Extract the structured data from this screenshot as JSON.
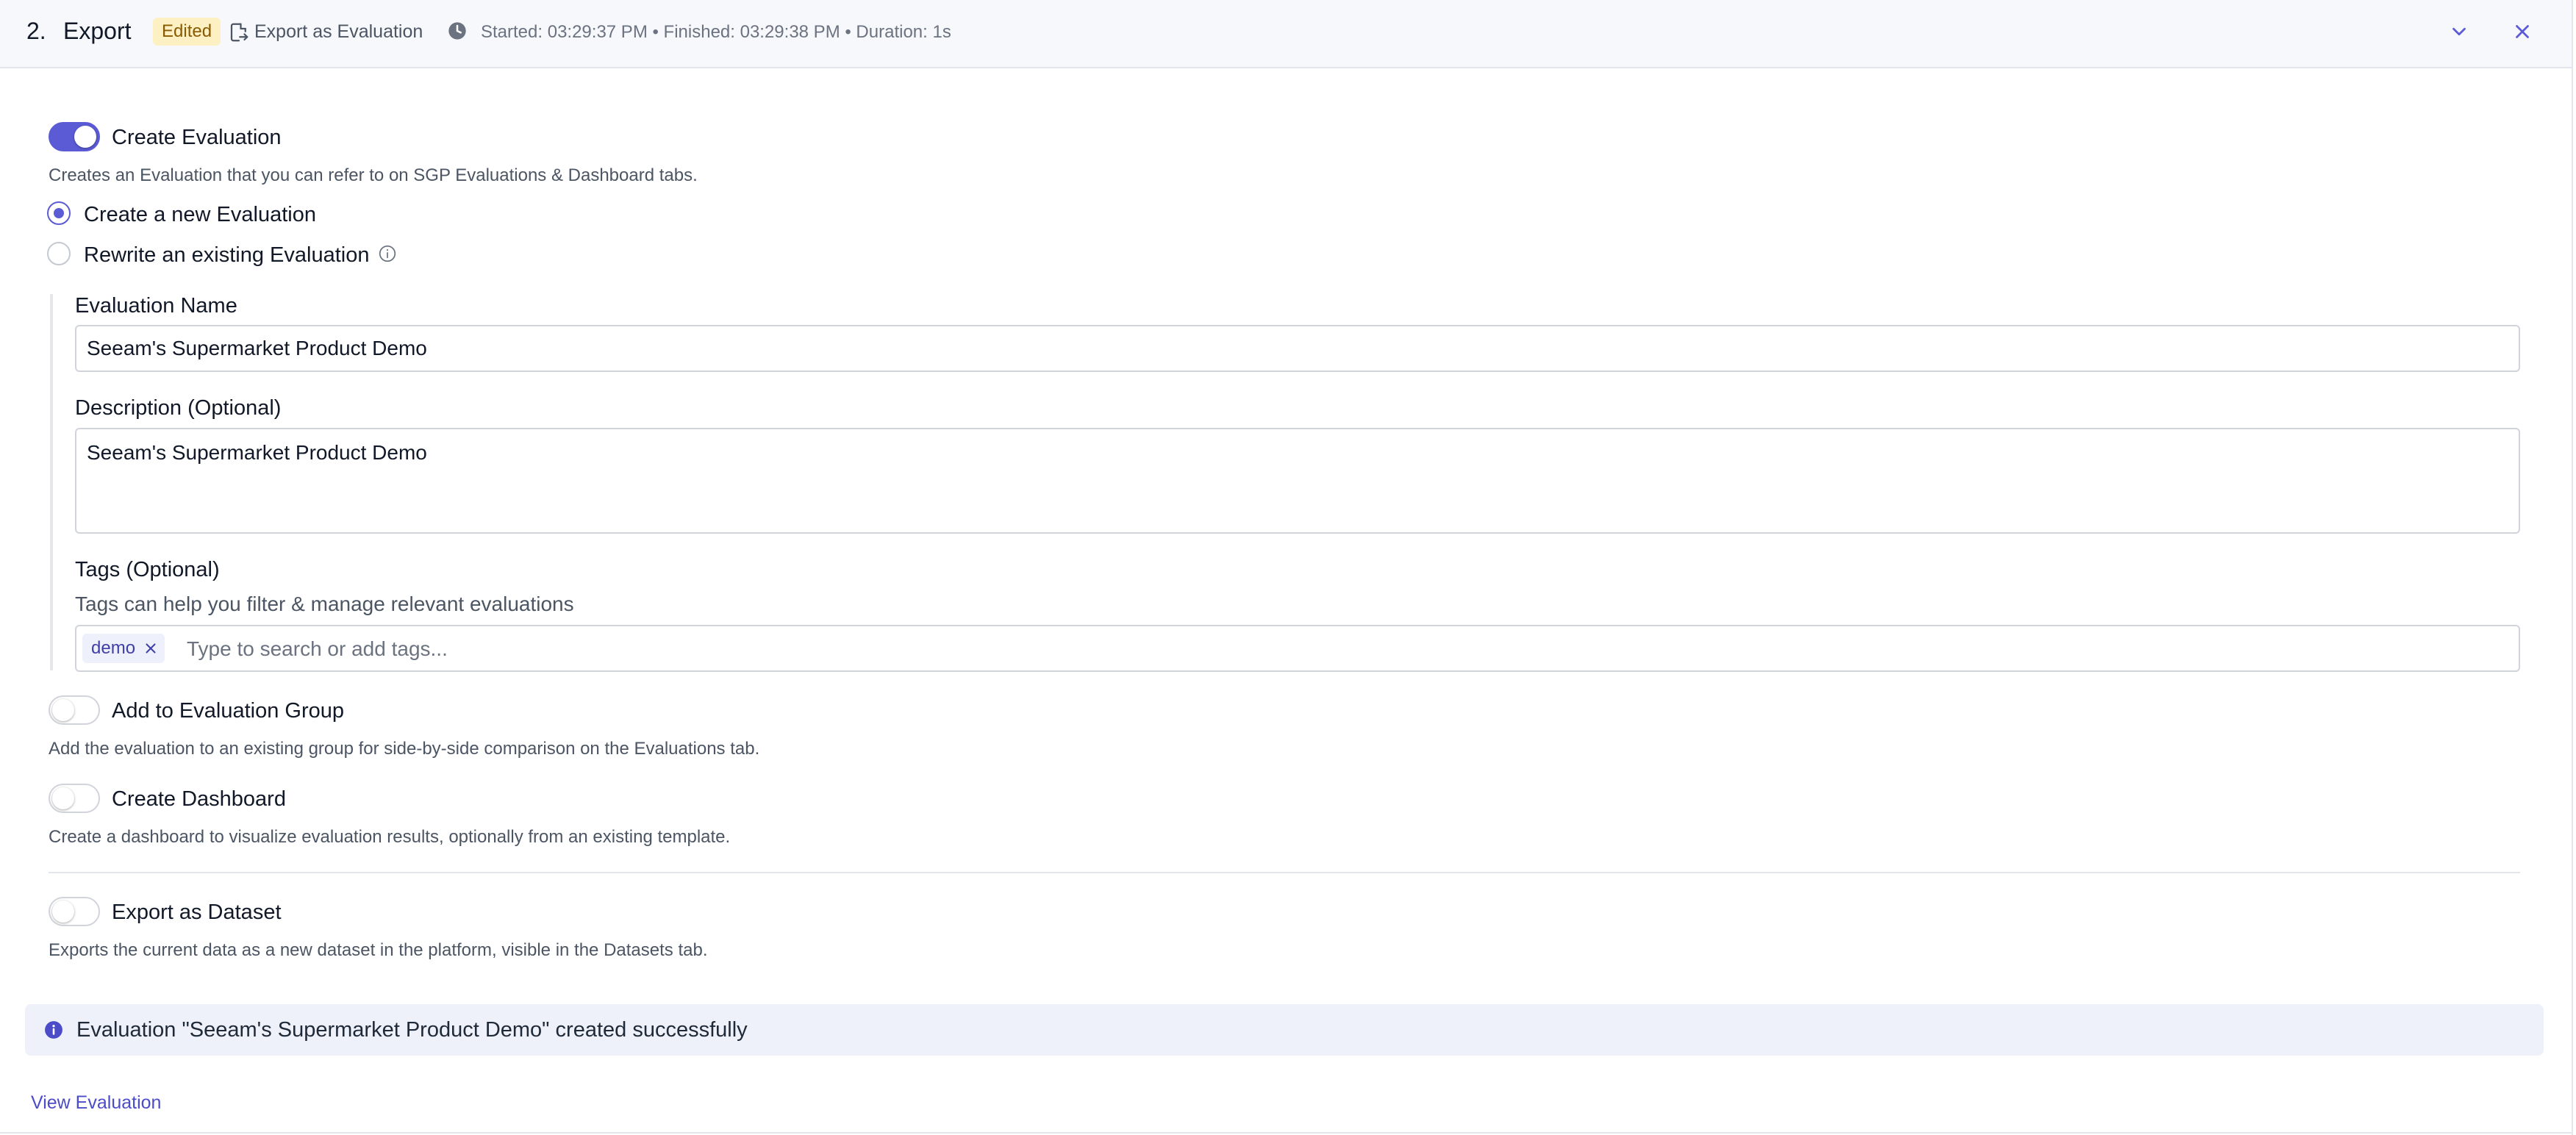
{
  "header": {
    "step_number": "2.",
    "title": "Export",
    "badge": "Edited",
    "export_label": "Export as Evaluation",
    "timing": "Started: 03:29:37 PM • Finished: 03:29:38 PM • Duration: 1s"
  },
  "create_evaluation": {
    "label": "Create Evaluation",
    "enabled": true,
    "description": "Creates an Evaluation that you can refer to on SGP Evaluations & Dashboard tabs.",
    "options": [
      {
        "label": "Create a new Evaluation",
        "selected": true
      },
      {
        "label": "Rewrite an existing Evaluation",
        "selected": false
      }
    ]
  },
  "form": {
    "name_label": "Evaluation Name",
    "name_value": "Seeam's Supermarket Product Demo",
    "description_label": "Description (Optional)",
    "description_value": "Seeam's Supermarket Product Demo",
    "tags_label": "Tags (Optional)",
    "tags_help": "Tags can help you filter & manage relevant evaluations",
    "tags": [
      "demo"
    ],
    "tags_placeholder": "Type to search or add tags..."
  },
  "evaluation_group": {
    "label": "Add to Evaluation Group",
    "enabled": false,
    "description": "Add the evaluation to an existing group for side-by-side comparison on the Evaluations tab."
  },
  "dashboard": {
    "label": "Create Dashboard",
    "enabled": false,
    "description": "Create a dashboard to visualize evaluation results, optionally from an existing template."
  },
  "dataset": {
    "label": "Export as Dataset",
    "enabled": false,
    "description": "Exports the current data as a new dataset in the platform, visible in the Datasets tab."
  },
  "banner": {
    "message": "Evaluation \"Seeam's Supermarket Product Demo\" created successfully"
  },
  "footer": {
    "view_link": "View Evaluation"
  },
  "colors": {
    "accent": "#5b5bd6",
    "badge_bg": "#fdf1c4",
    "banner_bg": "#eef1fa",
    "link": "#4c4cc8"
  },
  "icons": [
    "file-export-icon",
    "clock-icon",
    "chevron-down-icon",
    "close-icon",
    "info-icon",
    "tag-remove-icon"
  ]
}
